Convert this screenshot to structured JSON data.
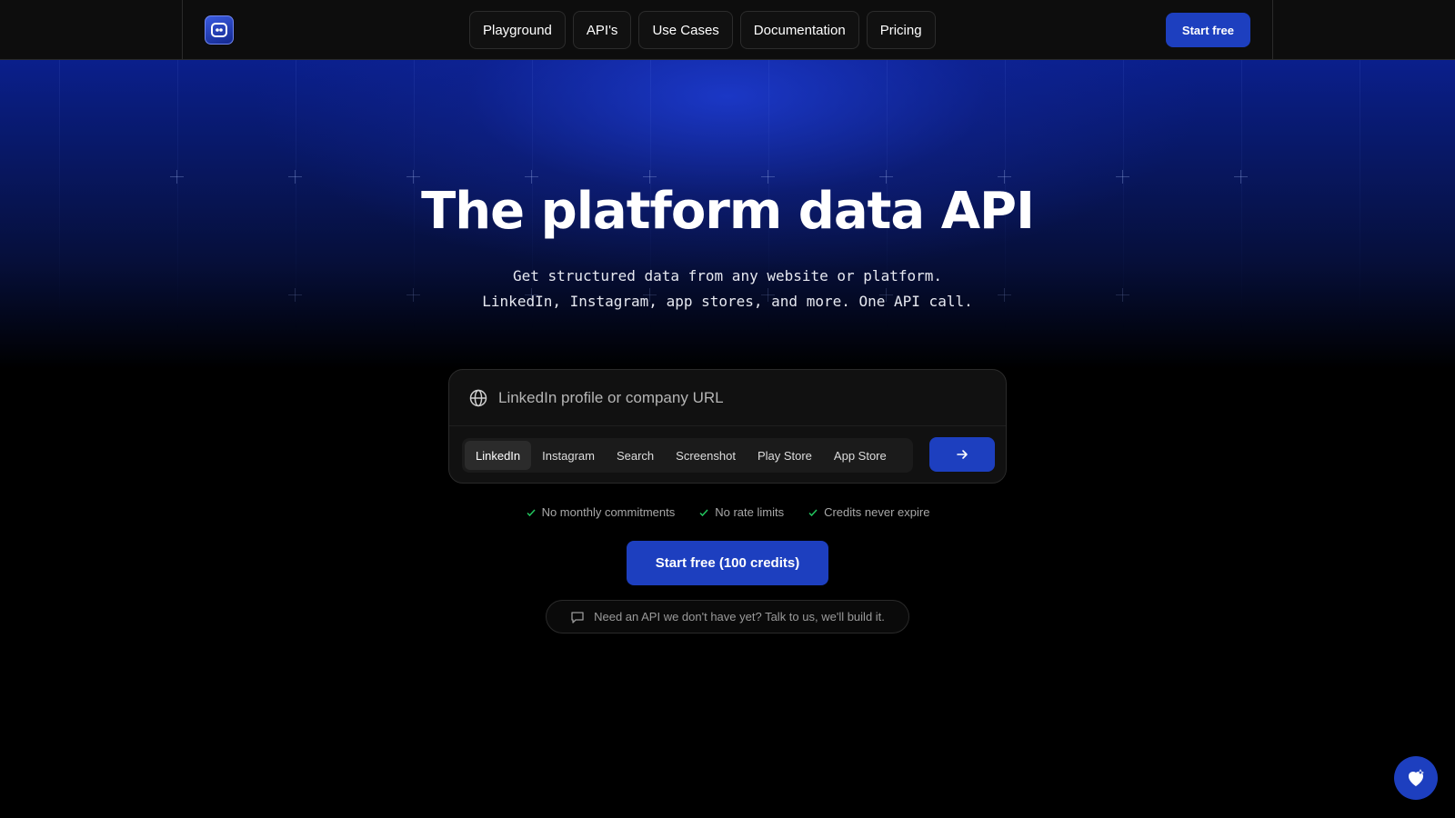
{
  "nav": {
    "items": [
      {
        "label": "Playground"
      },
      {
        "label": "API's"
      },
      {
        "label": "Use Cases"
      },
      {
        "label": "Documentation"
      },
      {
        "label": "Pricing"
      }
    ],
    "start_label": "Start free"
  },
  "hero": {
    "title": "The platform data API",
    "subtitle_line1": "Get structured data from any website or platform.",
    "subtitle_line2": "LinkedIn, Instagram, app stores, and more. One API call."
  },
  "search": {
    "placeholder": "LinkedIn profile or company URL",
    "tabs": [
      "LinkedIn",
      "Instagram",
      "Search",
      "Screenshot",
      "Play Store",
      "App Store"
    ],
    "active_tab": "LinkedIn"
  },
  "features": [
    "No monthly commitments",
    "No rate limits",
    "Credits never expire"
  ],
  "cta_label": "Start free (100 credits)",
  "talk_label": "Need an API we don't have yet? Talk to us, we'll build it.",
  "colors": {
    "accent": "#1d3fbf",
    "check": "#22c55e"
  },
  "icons": [
    "logo-icon",
    "globe-icon",
    "arrow-right-icon",
    "check-icon",
    "chat-bubble-icon",
    "chat-widget-icon"
  ]
}
